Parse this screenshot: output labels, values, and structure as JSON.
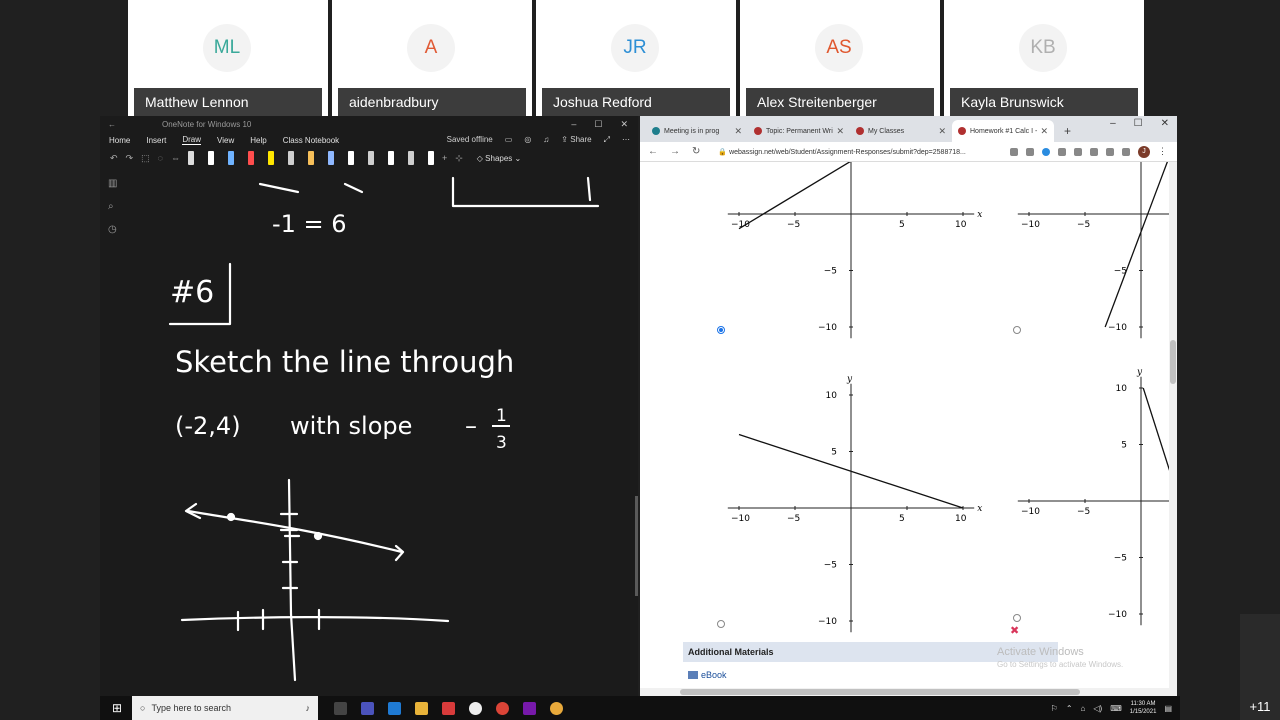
{
  "participants": [
    {
      "initials": "ML",
      "name": "Matthew Lennon",
      "color": "#3aa99a"
    },
    {
      "initials": "A",
      "name": "aidenbradbury",
      "color": "#e05a35"
    },
    {
      "initials": "JR",
      "name": "Joshua Redford",
      "color": "#2d8fd5"
    },
    {
      "initials": "AS",
      "name": "Alex Streitenberger",
      "color": "#e0582f"
    },
    {
      "initials": "KB",
      "name": "Kayla Brunswick",
      "color": "#b0b0b0"
    }
  ],
  "onenote": {
    "title": "OneNote for Windows 10",
    "menu": [
      "Home",
      "Insert",
      "Draw",
      "View",
      "Help",
      "Class Notebook"
    ],
    "active_menu": "Draw",
    "status": "Saved offline",
    "share": "Share",
    "shapes": "Shapes",
    "pen_colors": [
      "#dddddd",
      "#ffffff",
      "#6fb3ff",
      "#ff4e4e",
      "#ffe600",
      "#cfcfcf",
      "#f7c05a",
      "#8fb8ff",
      "#ffffff",
      "#cfcfcf",
      "#ffffff",
      "#cfcfcf",
      "#ffffff"
    ],
    "ink": {
      "line1": "-1 = 6",
      "heading": "#6",
      "line2": "Sketch the line through",
      "line3_point": "(-2,4)",
      "line3_with": "with slope",
      "slope_num": "1",
      "slope_den": "3",
      "slope_sign": "–"
    }
  },
  "chrome": {
    "tabs": [
      {
        "label": "Meeting is in prog",
        "color": "#1e7e8c"
      },
      {
        "label": "Topic: Permanent Wri",
        "color": "#b03030"
      },
      {
        "label": "My Classes",
        "color": "#b03030"
      },
      {
        "label": "Homework #1 Calc I -",
        "color": "#b03030"
      }
    ],
    "active_tab": 3,
    "url": "webassign.net/web/Student/Assignment-Responses/submit?dep=2588718...",
    "profile_initial": "J",
    "additional_materials": "Additional Materials",
    "ebook": "eBook",
    "activate_title": "Activate Windows",
    "activate_sub": "Go to Settings to activate Windows."
  },
  "graphs": {
    "x_label": "x",
    "y_label": "y",
    "tick_x": [
      "−10",
      "−5",
      "5",
      "10"
    ],
    "tick_y": [
      "10",
      "5",
      "−5",
      "−10"
    ]
  },
  "taskbar": {
    "search_placeholder": "Type here to search",
    "time": "11:30 AM",
    "date": "1/15/2021",
    "overflow_count": "+11"
  }
}
